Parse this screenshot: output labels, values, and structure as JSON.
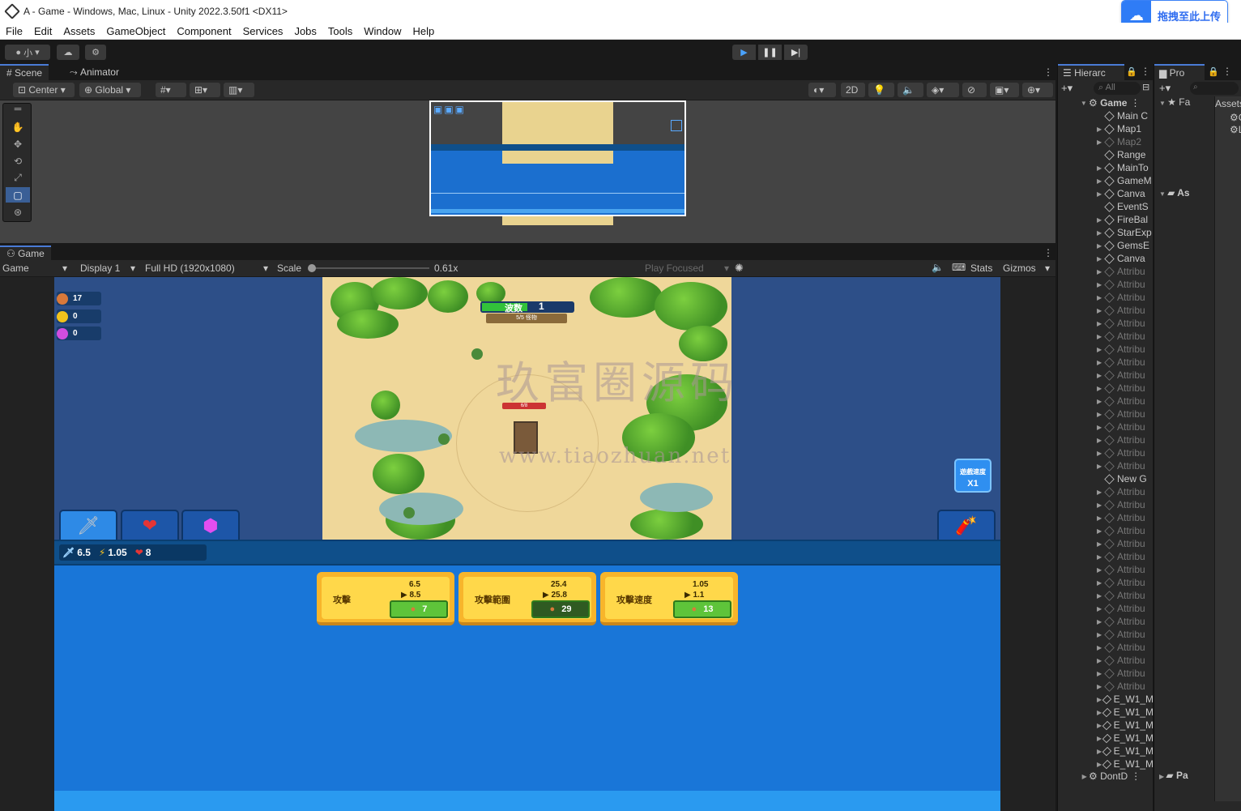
{
  "window": {
    "title": "A - Game - Windows, Mac, Linux - Unity 2022.3.50f1 <DX11>"
  },
  "upload": {
    "label": "拖拽至此上传"
  },
  "menu": [
    "File",
    "Edit",
    "Assets",
    "GameObject",
    "Component",
    "Services",
    "Jobs",
    "Tools",
    "Window",
    "Help"
  ],
  "toolbar": {
    "account": "小"
  },
  "scene_tabs": {
    "scene": "Scene",
    "animator": "Animator"
  },
  "scene_toolbar": {
    "pivot": "Center",
    "space": "Global",
    "mode2d": "2D"
  },
  "game_tab": {
    "label": "Game"
  },
  "game_toolbar": {
    "view": "Game",
    "display": "Display 1",
    "resolution": "Full HD (1920x1080)",
    "scale_label": "Scale",
    "scale_value": "0.61x",
    "play_focused": "Play Focused",
    "stats": "Stats",
    "gizmos": "Gizmos"
  },
  "game": {
    "resources": [
      {
        "value": "17",
        "color": "#d9793a"
      },
      {
        "value": "0",
        "color": "#f2c21b"
      },
      {
        "value": "0",
        "color": "#d14de0"
      }
    ],
    "wave": {
      "label": "波数",
      "number": "1",
      "sub": "5/5 怪物"
    },
    "tower_hp": "6/8",
    "speed": {
      "label": "遊戲速度",
      "value": "X1"
    },
    "stats": {
      "attack": "6.5",
      "speed": "1.05",
      "hp": "8"
    },
    "upgrades": [
      {
        "name": "攻擊",
        "current": "6.5",
        "next": "8.5",
        "cost": "7"
      },
      {
        "name": "攻擊範圍",
        "current": "25.4",
        "next": "25.8",
        "cost": "29"
      },
      {
        "name": "攻擊速度",
        "current": "1.05",
        "next": "1.1",
        "cost": "13"
      }
    ]
  },
  "watermark": {
    "cn": "玖富圈源码",
    "url": "www.tiaozhuan.net"
  },
  "hierarchy": {
    "tab": "Hierarc",
    "search": "All",
    "root": "Game",
    "items": [
      {
        "label": "Main C",
        "dim": false,
        "arrow": false
      },
      {
        "label": "Map1",
        "dim": false,
        "arrow": true
      },
      {
        "label": "Map2",
        "dim": true,
        "arrow": true
      },
      {
        "label": "Range",
        "dim": false,
        "arrow": false
      },
      {
        "label": "MainTo",
        "dim": false,
        "arrow": true
      },
      {
        "label": "GameM",
        "dim": false,
        "arrow": true
      },
      {
        "label": "Canva",
        "dim": false,
        "arrow": true
      },
      {
        "label": "EventS",
        "dim": false,
        "arrow": false
      },
      {
        "label": "FireBal",
        "dim": false,
        "arrow": true
      },
      {
        "label": "StarExp",
        "dim": false,
        "arrow": true
      },
      {
        "label": "GemsE",
        "dim": false,
        "arrow": true
      },
      {
        "label": "Canva",
        "dim": false,
        "arrow": true
      },
      {
        "label": "Attribu",
        "dim": true,
        "arrow": true
      },
      {
        "label": "Attribu",
        "dim": true,
        "arrow": true
      },
      {
        "label": "Attribu",
        "dim": true,
        "arrow": true
      },
      {
        "label": "Attribu",
        "dim": true,
        "arrow": true
      },
      {
        "label": "Attribu",
        "dim": true,
        "arrow": true
      },
      {
        "label": "Attribu",
        "dim": true,
        "arrow": true
      },
      {
        "label": "Attribu",
        "dim": true,
        "arrow": true
      },
      {
        "label": "Attribu",
        "dim": true,
        "arrow": true
      },
      {
        "label": "Attribu",
        "dim": true,
        "arrow": true
      },
      {
        "label": "Attribu",
        "dim": true,
        "arrow": true
      },
      {
        "label": "Attribu",
        "dim": true,
        "arrow": true
      },
      {
        "label": "Attribu",
        "dim": true,
        "arrow": true
      },
      {
        "label": "Attribu",
        "dim": true,
        "arrow": true
      },
      {
        "label": "Attribu",
        "dim": true,
        "arrow": true
      },
      {
        "label": "Attribu",
        "dim": true,
        "arrow": true
      },
      {
        "label": "Attribu",
        "dim": true,
        "arrow": true
      },
      {
        "label": "New G",
        "dim": false,
        "arrow": false
      },
      {
        "label": "Attribu",
        "dim": true,
        "arrow": true
      },
      {
        "label": "Attribu",
        "dim": true,
        "arrow": true
      },
      {
        "label": "Attribu",
        "dim": true,
        "arrow": true
      },
      {
        "label": "Attribu",
        "dim": true,
        "arrow": true
      },
      {
        "label": "Attribu",
        "dim": true,
        "arrow": true
      },
      {
        "label": "Attribu",
        "dim": true,
        "arrow": true
      },
      {
        "label": "Attribu",
        "dim": true,
        "arrow": true
      },
      {
        "label": "Attribu",
        "dim": true,
        "arrow": true
      },
      {
        "label": "Attribu",
        "dim": true,
        "arrow": true
      },
      {
        "label": "Attribu",
        "dim": true,
        "arrow": true
      },
      {
        "label": "Attribu",
        "dim": true,
        "arrow": true
      },
      {
        "label": "Attribu",
        "dim": true,
        "arrow": true
      },
      {
        "label": "Attribu",
        "dim": true,
        "arrow": true
      },
      {
        "label": "Attribu",
        "dim": true,
        "arrow": true
      },
      {
        "label": "Attribu",
        "dim": true,
        "arrow": true
      },
      {
        "label": "Attribu",
        "dim": true,
        "arrow": true
      },
      {
        "label": "E_W1_M",
        "dim": false,
        "arrow": true
      },
      {
        "label": "E_W1_M",
        "dim": false,
        "arrow": true
      },
      {
        "label": "E_W1_M",
        "dim": false,
        "arrow": true
      },
      {
        "label": "E_W1_M",
        "dim": false,
        "arrow": true
      },
      {
        "label": "E_W1_M",
        "dim": false,
        "arrow": true
      },
      {
        "label": "E_W1_M",
        "dim": false,
        "arrow": true
      }
    ],
    "footer": "DontD"
  },
  "project": {
    "tab": "Pro",
    "favorites": "Fa",
    "assets_root": "As",
    "packages": "Pa",
    "assets_label": "Assets",
    "assets_items": [
      "Ga",
      "Lo"
    ]
  }
}
